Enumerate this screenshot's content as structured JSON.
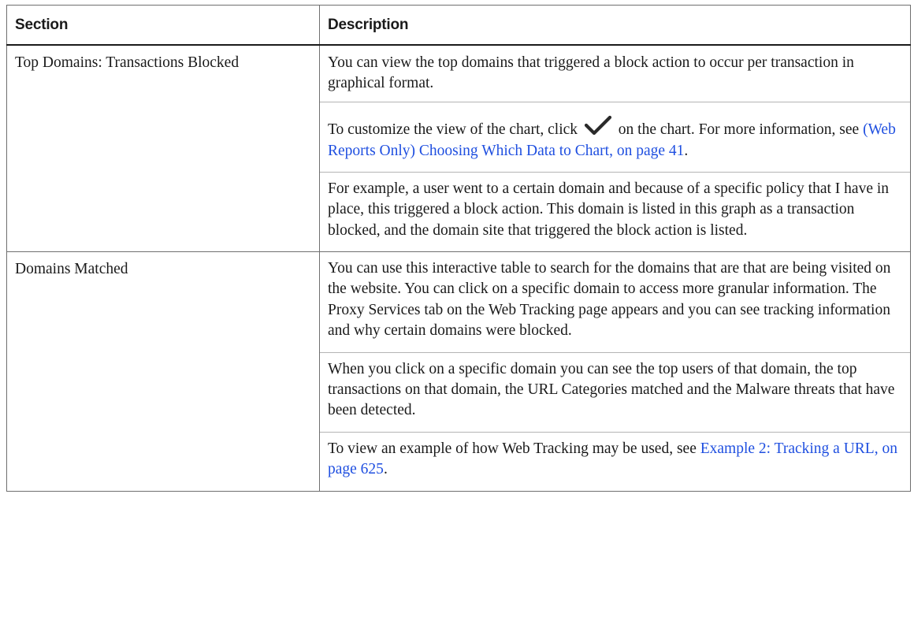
{
  "table": {
    "headers": {
      "section": "Section",
      "description": "Description"
    },
    "rows": [
      {
        "section": "Top Domains: Transactions Blocked",
        "paragraphs": {
          "p1": "You can view the top domains that triggered a block action to occur per transaction in graphical format.",
          "p2_before_icon": "To customize the view of the chart, click",
          "p2_after_icon": "on the chart. For more information, see",
          "p2_link": "(Web Reports Only) Choosing Which Data to Chart, on page 41",
          "p2_end": ".",
          "p3": "For example, a user went to a certain domain and because of a specific policy that I have in place, this triggered a block action. This domain is listed in this graph as a transaction blocked, and the domain site that triggered the block action is listed."
        }
      },
      {
        "section": "Domains Matched",
        "paragraphs": {
          "p1": "You can use this interactive table to search for the domains that are that are being visited on the website. You can click on a specific domain to access more granular information. The Proxy Services tab on the Web Tracking page appears and you can see tracking information and why certain domains were blocked.",
          "p2": "When you click on a specific domain you can see the top users of that domain, the top transactions on that domain, the URL Categories matched and the Malware threats that have been detected.",
          "p3_before_link": "To view an example of how Web Tracking may be used, see",
          "p3_link": "Example 2: Tracking a URL, on page 625",
          "p3_end": "."
        }
      }
    ]
  },
  "icons": {
    "customize": "checkmark-icon"
  },
  "colors": {
    "link": "#1f4fe0",
    "border": "#6f6f6f",
    "header_rule": "#1a1a1a",
    "check": "#2a2a2a"
  }
}
